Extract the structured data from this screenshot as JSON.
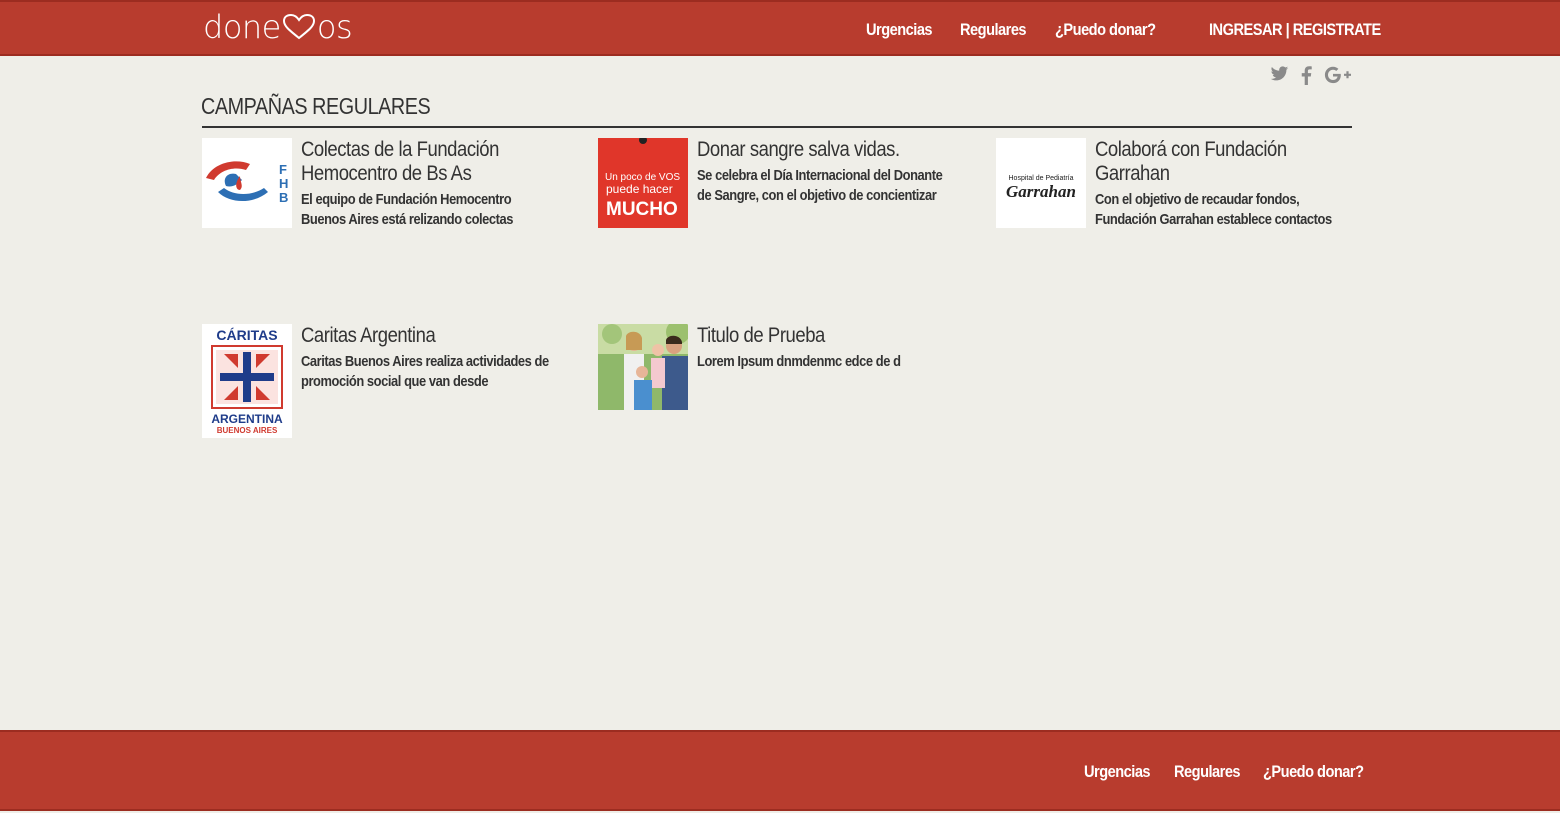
{
  "header": {
    "logo": {
      "left": "done",
      "right": "os"
    },
    "nav": [
      "Urgencias",
      "Regulares",
      "¿Puedo donar?"
    ],
    "login": "INGRESAR",
    "separator": "|",
    "register": "REGISTRATE"
  },
  "social": [
    "twitter-icon",
    "facebook-icon",
    "google-plus-icon"
  ],
  "section": {
    "title": "CAMPAÑAS REGULARES"
  },
  "campaigns": [
    {
      "title": "Colectas de la Fundación Hemocentro de Bs As",
      "desc": "El equipo de Fundación Hemocentro Buenos Aires está relizando colectas",
      "logo_text": "FHB"
    },
    {
      "title": "Donar sangre salva vidas.",
      "desc": "Se celebra el Día Internacional del Donante de Sangre, con el objetivo de concientizar",
      "logo_line1": "Un poco de VOS",
      "logo_line2": "puede hacer",
      "logo_line3": "MUCHO"
    },
    {
      "title": "Colaborá con Fundación Garrahan",
      "desc": "Con el objetivo de recaudar fondos, Fundación Garrahan establece contactos",
      "logo_line1": "Hospital de Pediatría",
      "logo_line2": "Garrahan"
    },
    {
      "title": "Caritas Argentina",
      "desc": "Caritas Buenos Aires realiza actividades de promoción social que van desde",
      "logo_line1": "CÁRITAS",
      "logo_line2": "ARGENTINA",
      "logo_line3": "BUENOS AIRES"
    },
    {
      "title": "Titulo de Prueba",
      "desc": "Lorem Ipsum dnmdenmc edce de d"
    }
  ],
  "footer": {
    "nav": [
      "Urgencias",
      "Regulares",
      "¿Puedo donar?"
    ]
  },
  "colors": {
    "brand": "#b83c2e",
    "background": "#efeee8",
    "text": "#333333",
    "social": "#8a8a8a"
  }
}
